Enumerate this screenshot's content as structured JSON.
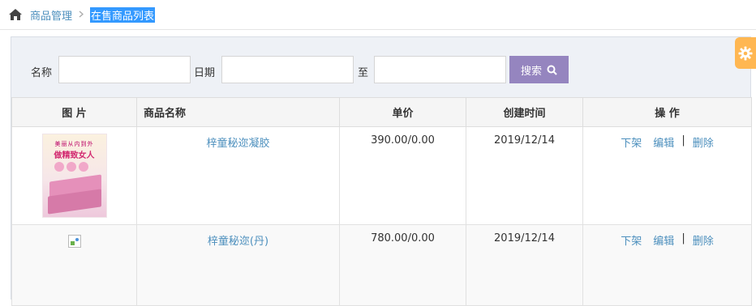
{
  "breadcrumb": {
    "home_icon": "home-icon",
    "parent": "商品管理",
    "separator": ">",
    "current": "在售商品列表"
  },
  "search": {
    "name_label": "名称",
    "name_value": "",
    "date_label": "日期",
    "date_from_value": "",
    "date_to_label": "至",
    "date_to_value": "",
    "button_label": "搜索",
    "button_icon": "search-icon",
    "button_color": "#9585bf"
  },
  "table": {
    "columns": [
      "图 片",
      "商品名称",
      "单价",
      "创建时间",
      "操 作"
    ],
    "rows": [
      {
        "image": "product-thumbnail",
        "thumb_text_top": "美丽从内到外",
        "thumb_text_main": "做精致女人",
        "name": "梓童秘迩凝胶",
        "price": "390.00/0.00",
        "created": "2019/12/14",
        "actions": [
          "下架",
          "编辑",
          "|",
          "删除"
        ]
      },
      {
        "image": "broken-image-icon",
        "name": "梓童秘迩(丹)",
        "price": "780.00/0.00",
        "created": "2019/12/14",
        "actions": [
          "下架",
          "编辑",
          "|",
          "删除"
        ]
      }
    ]
  },
  "settings_tab": {
    "icon": "gear-icon",
    "color": "#ffb752"
  },
  "colors": {
    "link": "#4c8fbd",
    "highlight": "#3399ff"
  }
}
